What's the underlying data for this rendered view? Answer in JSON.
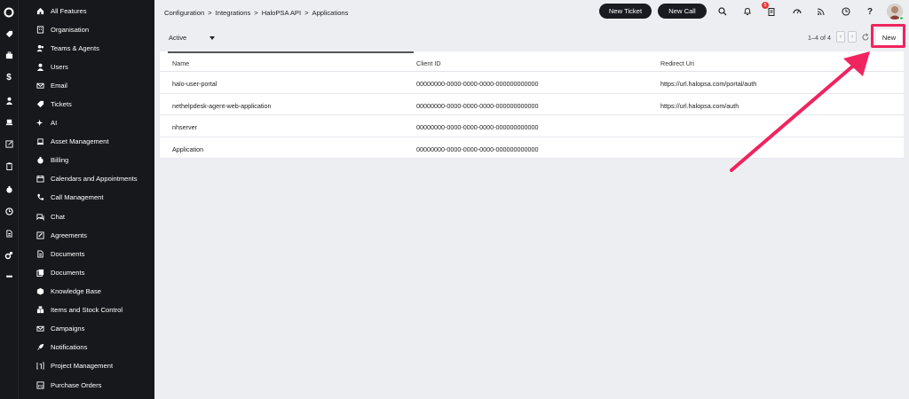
{
  "rail": {
    "items": [
      {
        "icon": "logo-circle-icon"
      },
      {
        "icon": "tag-icon"
      },
      {
        "icon": "briefcase-icon"
      },
      {
        "icon": "dollar-icon"
      },
      {
        "icon": "user-icon"
      },
      {
        "icon": "laptop-icon"
      },
      {
        "icon": "edit-icon"
      },
      {
        "icon": "clipboard-icon"
      },
      {
        "icon": "money-bag-icon"
      },
      {
        "icon": "clock-icon"
      },
      {
        "icon": "document-icon"
      },
      {
        "icon": "settings-icon"
      },
      {
        "icon": "more-icon"
      }
    ]
  },
  "sidebar": {
    "items": [
      {
        "label": "All Features",
        "icon": "home-icon"
      },
      {
        "label": "Organisation",
        "icon": "building-icon"
      },
      {
        "label": "Teams & Agents",
        "icon": "team-icon"
      },
      {
        "label": "Users",
        "icon": "user-icon"
      },
      {
        "label": "Email",
        "icon": "email-icon"
      },
      {
        "label": "Tickets",
        "icon": "ticket-icon"
      },
      {
        "label": "AI",
        "icon": "sparkle-icon"
      },
      {
        "label": "Asset Management",
        "icon": "laptop-icon"
      },
      {
        "label": "Billing",
        "icon": "money-bag-icon"
      },
      {
        "label": "Calendars and Appointments",
        "icon": "calendar-icon"
      },
      {
        "label": "Call Management",
        "icon": "phone-icon"
      },
      {
        "label": "Chat",
        "icon": "chat-icon"
      },
      {
        "label": "Agreements",
        "icon": "agreement-icon"
      },
      {
        "label": "Documents",
        "icon": "document-icon"
      },
      {
        "label": "Documents",
        "icon": "documents-icon"
      },
      {
        "label": "Knowledge Base",
        "icon": "box-icon"
      },
      {
        "label": "Items and Stock Control",
        "icon": "boxes-icon"
      },
      {
        "label": "Campaigns",
        "icon": "campaign-icon"
      },
      {
        "label": "Notifications",
        "icon": "rocket-icon"
      },
      {
        "label": "Project Management",
        "icon": "project-icon"
      },
      {
        "label": "Purchase Orders",
        "icon": "po-icon"
      }
    ]
  },
  "header": {
    "breadcrumb": [
      "Configuration",
      ">",
      "Integrations",
      ">",
      "HaloPSA API",
      ">",
      "Applications"
    ],
    "new_ticket_label": "New Ticket",
    "new_call_label": "New Call",
    "notification_count": "5"
  },
  "toolbar": {
    "filter_value": "Active",
    "pager_text": "1–4 of 4",
    "new_label": "New"
  },
  "table": {
    "columns": [
      "Name",
      "Client ID",
      "Redirect Uri"
    ],
    "rows": [
      [
        "halo-user-portal",
        "00000000-0000-0000-0000-000000000000",
        "https://url.halopsa.com/portal/auth"
      ],
      [
        "nethelpdesk-agent-web-application",
        "00000000-0000-0000-0000-000000000000",
        "https://url.halopsa.com/auth"
      ],
      [
        "nhserver",
        "00000000-0000-0000-0000-000000000000",
        ""
      ],
      [
        "Application",
        "00000000-0000-0000-0000-000000000000",
        ""
      ]
    ]
  },
  "colors": {
    "sidebar_bg": "#17181c",
    "page_bg": "#edeef2",
    "highlight": "#f0245f",
    "badge": "#e63b3b"
  }
}
